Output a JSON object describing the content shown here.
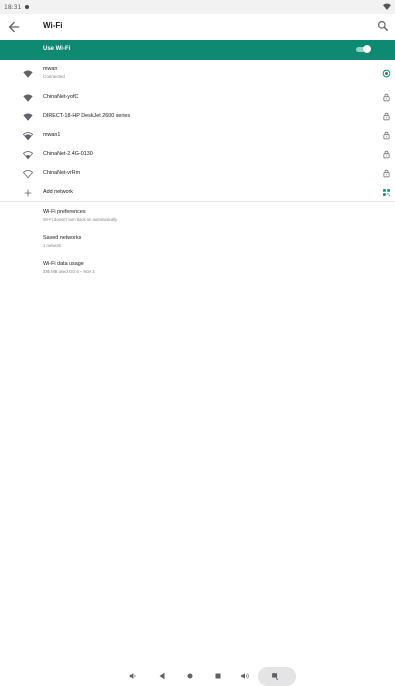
{
  "status_bar": {
    "time": "18:31",
    "icons": [
      "notification-dot-icon",
      "wifi-signal-icon"
    ]
  },
  "app_bar": {
    "title": "Wi-Fi",
    "icons": [
      "back-arrow-icon",
      "search-icon"
    ]
  },
  "master_switch": {
    "label": "Use Wi-Fi",
    "on": true
  },
  "networks": [
    {
      "name": "mwan",
      "status": "Connected",
      "signal": "full",
      "right_icon": "connected-settings-icon"
    },
    {
      "name": "ChinaNet-yofC",
      "status": "",
      "signal": "full",
      "right_icon": "lock-icon"
    },
    {
      "name": "DIRECT-18-HP DeskJet 2600 series",
      "status": "",
      "signal": "full",
      "right_icon": "lock-icon"
    },
    {
      "name": "mwan1",
      "status": "",
      "signal": "strong",
      "right_icon": "lock-icon"
    },
    {
      "name": "ChinaNet-2.4G-0130",
      "status": "",
      "signal": "medium",
      "right_icon": "lock-icon"
    },
    {
      "name": "ChinaNet-vrRm",
      "status": "",
      "signal": "weak",
      "right_icon": "lock-icon"
    }
  ],
  "add_network": {
    "label": "Add network",
    "icons": [
      "plus-icon",
      "qr-code-icon"
    ]
  },
  "preferences": [
    {
      "title": "Wi-Fi preferences",
      "subtitle": "Wi-Fi doesn't turn back on automatically"
    },
    {
      "title": "Saved networks",
      "subtitle": "1 network"
    },
    {
      "title": "Wi-Fi data usage",
      "subtitle": "295 MB used Oct 6 – Nov 3"
    }
  ],
  "navigation_bar": {
    "icons": [
      "volume-down-icon",
      "back-triangle-icon",
      "home-circle-icon",
      "recents-square-icon",
      "volume-up-icon",
      "screenshot-icon"
    ]
  },
  "colors": {
    "accent": "#0f8a72",
    "primary_text": "#202124",
    "secondary_text": "#80868b",
    "icon": "#5f6368"
  }
}
